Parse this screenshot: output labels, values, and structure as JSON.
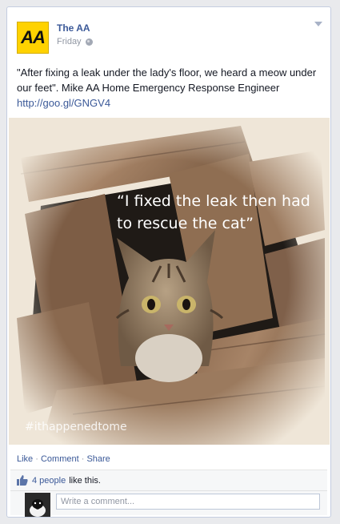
{
  "post": {
    "page_name": "The AA",
    "logo_text": "AA",
    "timestamp": "Friday",
    "privacy_icon": "globe-icon",
    "text": "\"After fixing a leak under the lady's floor, we heard a meow under our feet\". Mike AA Home Emergency Response Engineer ",
    "link": "http://goo.gl/GNGV4"
  },
  "photo": {
    "quote": "“I fixed the leak then had to rescue the cat”",
    "quote_line1": "“I fixed the leak then had",
    "quote_line2": "to rescue the cat”",
    "hashtag": "#ithappenedtome"
  },
  "actions": {
    "like": "Like",
    "comment": "Comment",
    "share": "Share",
    "separator": " · "
  },
  "feedback": {
    "like_count_link": "4 people",
    "like_suffix": "like this.",
    "comment_placeholder": "Write a comment..."
  },
  "colors": {
    "link": "#3b5998",
    "brand_yellow": "#ffd200",
    "background": "#e9eaed"
  }
}
